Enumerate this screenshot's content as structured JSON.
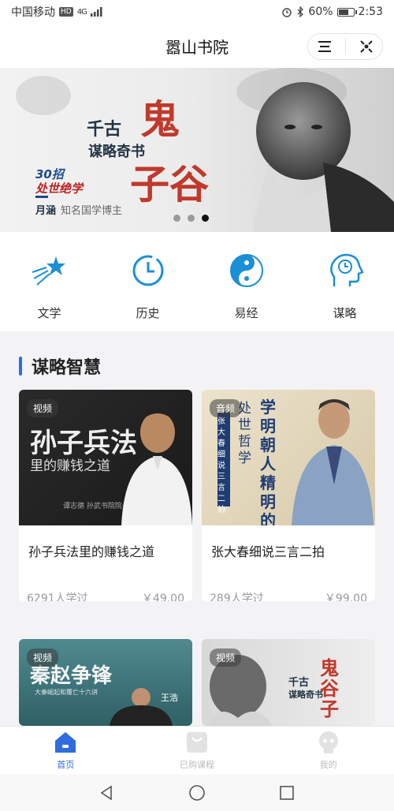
{
  "status": {
    "carrier": "中国移动",
    "hd": "HD",
    "network": "4G",
    "battery": "60%",
    "battery_level": 0.6,
    "time": "2:53"
  },
  "header": {
    "title": "嚣山书院"
  },
  "banner": {
    "line1": "千古",
    "line2": "谋略奇书",
    "big1": "鬼",
    "big2": "子谷",
    "tagline1": "30招",
    "tagline2": "处世绝学",
    "author": "月涵",
    "author_desc": "知名国学博主",
    "slide_count": 3,
    "active_slide": 3
  },
  "categories": [
    {
      "label": "文学",
      "icon": "shooting-star-icon"
    },
    {
      "label": "历史",
      "icon": "clock-icon"
    },
    {
      "label": "易经",
      "icon": "yin-yang-icon"
    },
    {
      "label": "谋略",
      "icon": "head-clock-icon"
    }
  ],
  "section": {
    "title": "谋略智慧"
  },
  "courses": [
    {
      "tag": "视频",
      "thumb_title": "孙子兵法",
      "thumb_sub": "里的赚钱之道",
      "thumb_author": "谭志德  孙武书院院长",
      "title": "孙子兵法里的赚钱之道",
      "learners": "6291人学过",
      "price": "￥49.00"
    },
    {
      "tag": "音频",
      "thumb_title": "学明朝人精明的",
      "thumb_sub": "处世哲学",
      "thumb_author": "张大春细说三言二拍",
      "title": "张大春细说三言二拍",
      "learners": "289人学过",
      "price": "￥99.00"
    },
    {
      "tag": "视频",
      "thumb_title": "秦赵争锋",
      "thumb_sub": "大秦崛起和覆亡十六讲",
      "thumb_author": "王浩",
      "title": "",
      "learners": "",
      "price": ""
    },
    {
      "tag": "视频",
      "thumb_title": "千古",
      "thumb_sub": "谋略奇书",
      "thumb_author": "鬼谷子",
      "title": "",
      "learners": "",
      "price": ""
    }
  ],
  "tabs": [
    {
      "label": "首页",
      "active": true
    },
    {
      "label": "已购课程",
      "active": false
    },
    {
      "label": "我的",
      "active": false
    }
  ],
  "colors": {
    "accent": "#2f6cdf",
    "icon_blue": "#1a8fd6",
    "banner_red": "#c0392b"
  }
}
